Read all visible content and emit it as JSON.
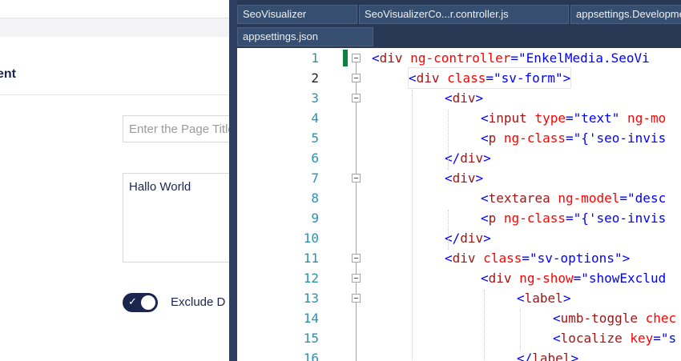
{
  "backoffice": {
    "panel_title": "ent",
    "page_title_placeholder": "Enter the Page Title",
    "description_value": "Hallo World",
    "exclude_label": "Exclude D",
    "toggle_checked": true
  },
  "editor": {
    "tabs": [
      "SeoVisualizer",
      "SeoVisualizerCo...r.controller.js",
      "appsettings.Development.json",
      "appsettings.json"
    ],
    "line_numbers": [
      "1",
      "2",
      "3",
      "4",
      "5",
      "6",
      "7",
      "8",
      "9",
      "10",
      "11",
      "12",
      "13",
      "14",
      "15",
      "16"
    ],
    "current_line": 2,
    "code_lines": [
      [
        [
          "pn",
          "<"
        ],
        [
          "tg",
          "div"
        ],
        [
          "at",
          " ng-controller"
        ],
        [
          "pn",
          "=\""
        ],
        [
          "vl",
          "EnkelMedia.SeoVi"
        ]
      ],
      [
        [
          "pn",
          "<"
        ],
        [
          "tg",
          "div"
        ],
        [
          "at",
          " class"
        ],
        [
          "pn",
          "=\""
        ],
        [
          "vl",
          "sv-form"
        ],
        [
          "pn",
          "\">"
        ]
      ],
      [
        [
          "pn",
          "<"
        ],
        [
          "tg",
          "div"
        ],
        [
          "pn",
          ">"
        ]
      ],
      [
        [
          "pn",
          "<"
        ],
        [
          "tg",
          "input"
        ],
        [
          "at",
          " type"
        ],
        [
          "pn",
          "=\""
        ],
        [
          "vl",
          "text"
        ],
        [
          "pn",
          "\""
        ],
        [
          "at",
          " ng-mo"
        ]
      ],
      [
        [
          "pn",
          "<"
        ],
        [
          "tg",
          "p"
        ],
        [
          "at",
          " ng-class"
        ],
        [
          "pn",
          "=\""
        ],
        [
          "vl",
          "{'seo-invis"
        ]
      ],
      [
        [
          "pn",
          "</"
        ],
        [
          "tg",
          "div"
        ],
        [
          "pn",
          ">"
        ]
      ],
      [
        [
          "pn",
          "<"
        ],
        [
          "tg",
          "div"
        ],
        [
          "pn",
          ">"
        ]
      ],
      [
        [
          "pn",
          "<"
        ],
        [
          "tg",
          "textarea"
        ],
        [
          "at",
          " ng-model"
        ],
        [
          "pn",
          "=\""
        ],
        [
          "vl",
          "desc"
        ]
      ],
      [
        [
          "pn",
          "<"
        ],
        [
          "tg",
          "p"
        ],
        [
          "at",
          " ng-class"
        ],
        [
          "pn",
          "=\""
        ],
        [
          "vl",
          "{'seo-invis"
        ]
      ],
      [
        [
          "pn",
          "</"
        ],
        [
          "tg",
          "div"
        ],
        [
          "pn",
          ">"
        ]
      ],
      [
        [
          "pn",
          "<"
        ],
        [
          "tg",
          "div"
        ],
        [
          "at",
          " class"
        ],
        [
          "pn",
          "=\""
        ],
        [
          "vl",
          "sv-options"
        ],
        [
          "pn",
          "\">"
        ]
      ],
      [
        [
          "pn",
          "<"
        ],
        [
          "tg",
          "div"
        ],
        [
          "at",
          " ng-show"
        ],
        [
          "pn",
          "=\""
        ],
        [
          "vl",
          "showExclud"
        ]
      ],
      [
        [
          "pn",
          "<"
        ],
        [
          "tg",
          "label"
        ],
        [
          "pn",
          ">"
        ]
      ],
      [
        [
          "pn",
          "<"
        ],
        [
          "tg",
          "umb-toggle"
        ],
        [
          "at",
          " chec"
        ]
      ],
      [
        [
          "pn",
          "<"
        ],
        [
          "tg",
          "localize"
        ],
        [
          "at",
          " key"
        ],
        [
          "pn",
          "=\""
        ],
        [
          "vl",
          "s"
        ]
      ],
      [
        [
          "pn",
          "</"
        ],
        [
          "tg",
          "label"
        ],
        [
          "pn",
          ">"
        ]
      ]
    ]
  }
}
